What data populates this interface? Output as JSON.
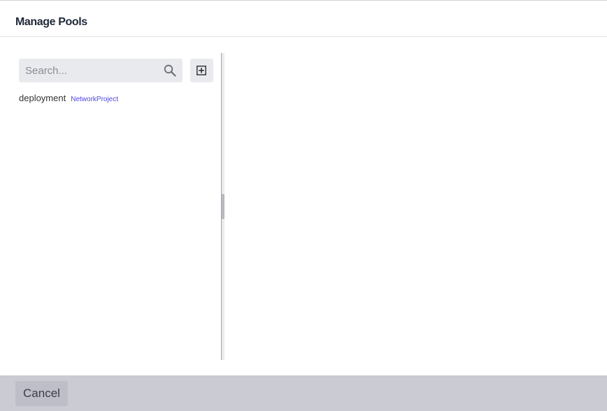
{
  "dialog": {
    "title": "Manage Pools"
  },
  "search": {
    "placeholder": "Search...",
    "value": "",
    "icon": "search-icon"
  },
  "toolbar": {
    "add_icon": "plus-square-icon"
  },
  "pools": [
    {
      "name": "deployment",
      "tag": "NetworkProject"
    }
  ],
  "footer": {
    "cancel_label": "Cancel"
  },
  "colors": {
    "tag": "#4f46e5",
    "footer_bg": "#cbcbd3",
    "input_bg": "#e9eaee"
  }
}
